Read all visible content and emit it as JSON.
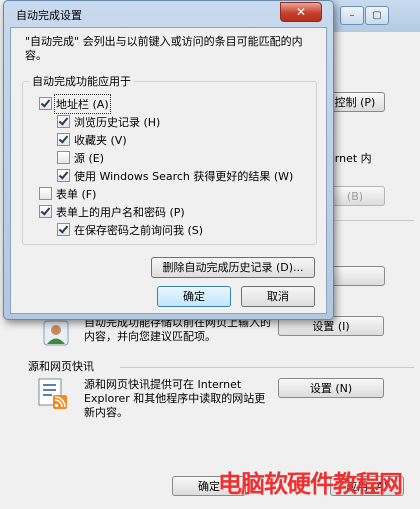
{
  "dialog": {
    "title": "自动完成设置",
    "close_label": "✕",
    "description": "\"自动完成\" 会列出与以前键入或访问的条目可能匹配的内容。",
    "group_label": "自动完成功能应用于",
    "options": [
      {
        "label": "地址栏 (A)",
        "checked": true,
        "focused": true
      },
      {
        "label": "浏览历史记录 (H)",
        "checked": true
      },
      {
        "label": "收藏夹 (V)",
        "checked": true
      },
      {
        "label": "源 (E)",
        "checked": false
      },
      {
        "label": "使用 Windows Search 获得更好的结果 (W)",
        "checked": true
      },
      {
        "label": "表单 (F)",
        "checked": false
      },
      {
        "label": "表单上的用户名和密码 (P)",
        "checked": true
      },
      {
        "label": "在保存密码之前询问我 (S)",
        "checked": true
      }
    ],
    "delete_history_button": "删除自动完成历史记录 (D)...",
    "ok_button": "确定",
    "cancel_button": "取消"
  },
  "background": {
    "title_buttons": [
      "–",
      "▢"
    ],
    "control_button": "控制 (P)",
    "internet_text": "ernet 内",
    "disabled_button": "(B)",
    "settings_btn_partial": "(I)",
    "autocomplete_text": "自动完成功能存储以前在网页上输入的内容，并向您建议匹配项。",
    "settings_button_1": "设置 (I)",
    "feeds_section_title": "源和网页快讯",
    "feeds_text": "源和网页快讯提供可在 Internet Explorer 和其他程序中读取的网站更新内容。",
    "settings_button_2": "设置 (N)",
    "bottom_ok": "确定",
    "bottom_apply": "应用 (A)"
  },
  "watermark": "电脑软硬件教程网"
}
